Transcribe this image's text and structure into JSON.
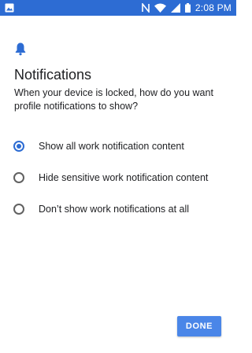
{
  "status_bar": {
    "time": "2:08 PM",
    "icons": [
      "image-icon",
      "nfc-icon",
      "wifi-icon",
      "signal-icon",
      "battery-icon"
    ]
  },
  "header": {
    "icon": "bell-icon",
    "title": "Notifications",
    "subtitle": "When your device is locked, how do you want profile notifications to show?"
  },
  "options": [
    {
      "label": "Show all work notification content",
      "selected": true
    },
    {
      "label": "Hide sensitive work notification content",
      "selected": false
    },
    {
      "label": "Don’t show work notifications at all",
      "selected": false
    }
  ],
  "footer": {
    "done_label": "DONE"
  },
  "colors": {
    "accent": "#2d6cd3",
    "button": "#4a86e8",
    "text": "#202124"
  }
}
